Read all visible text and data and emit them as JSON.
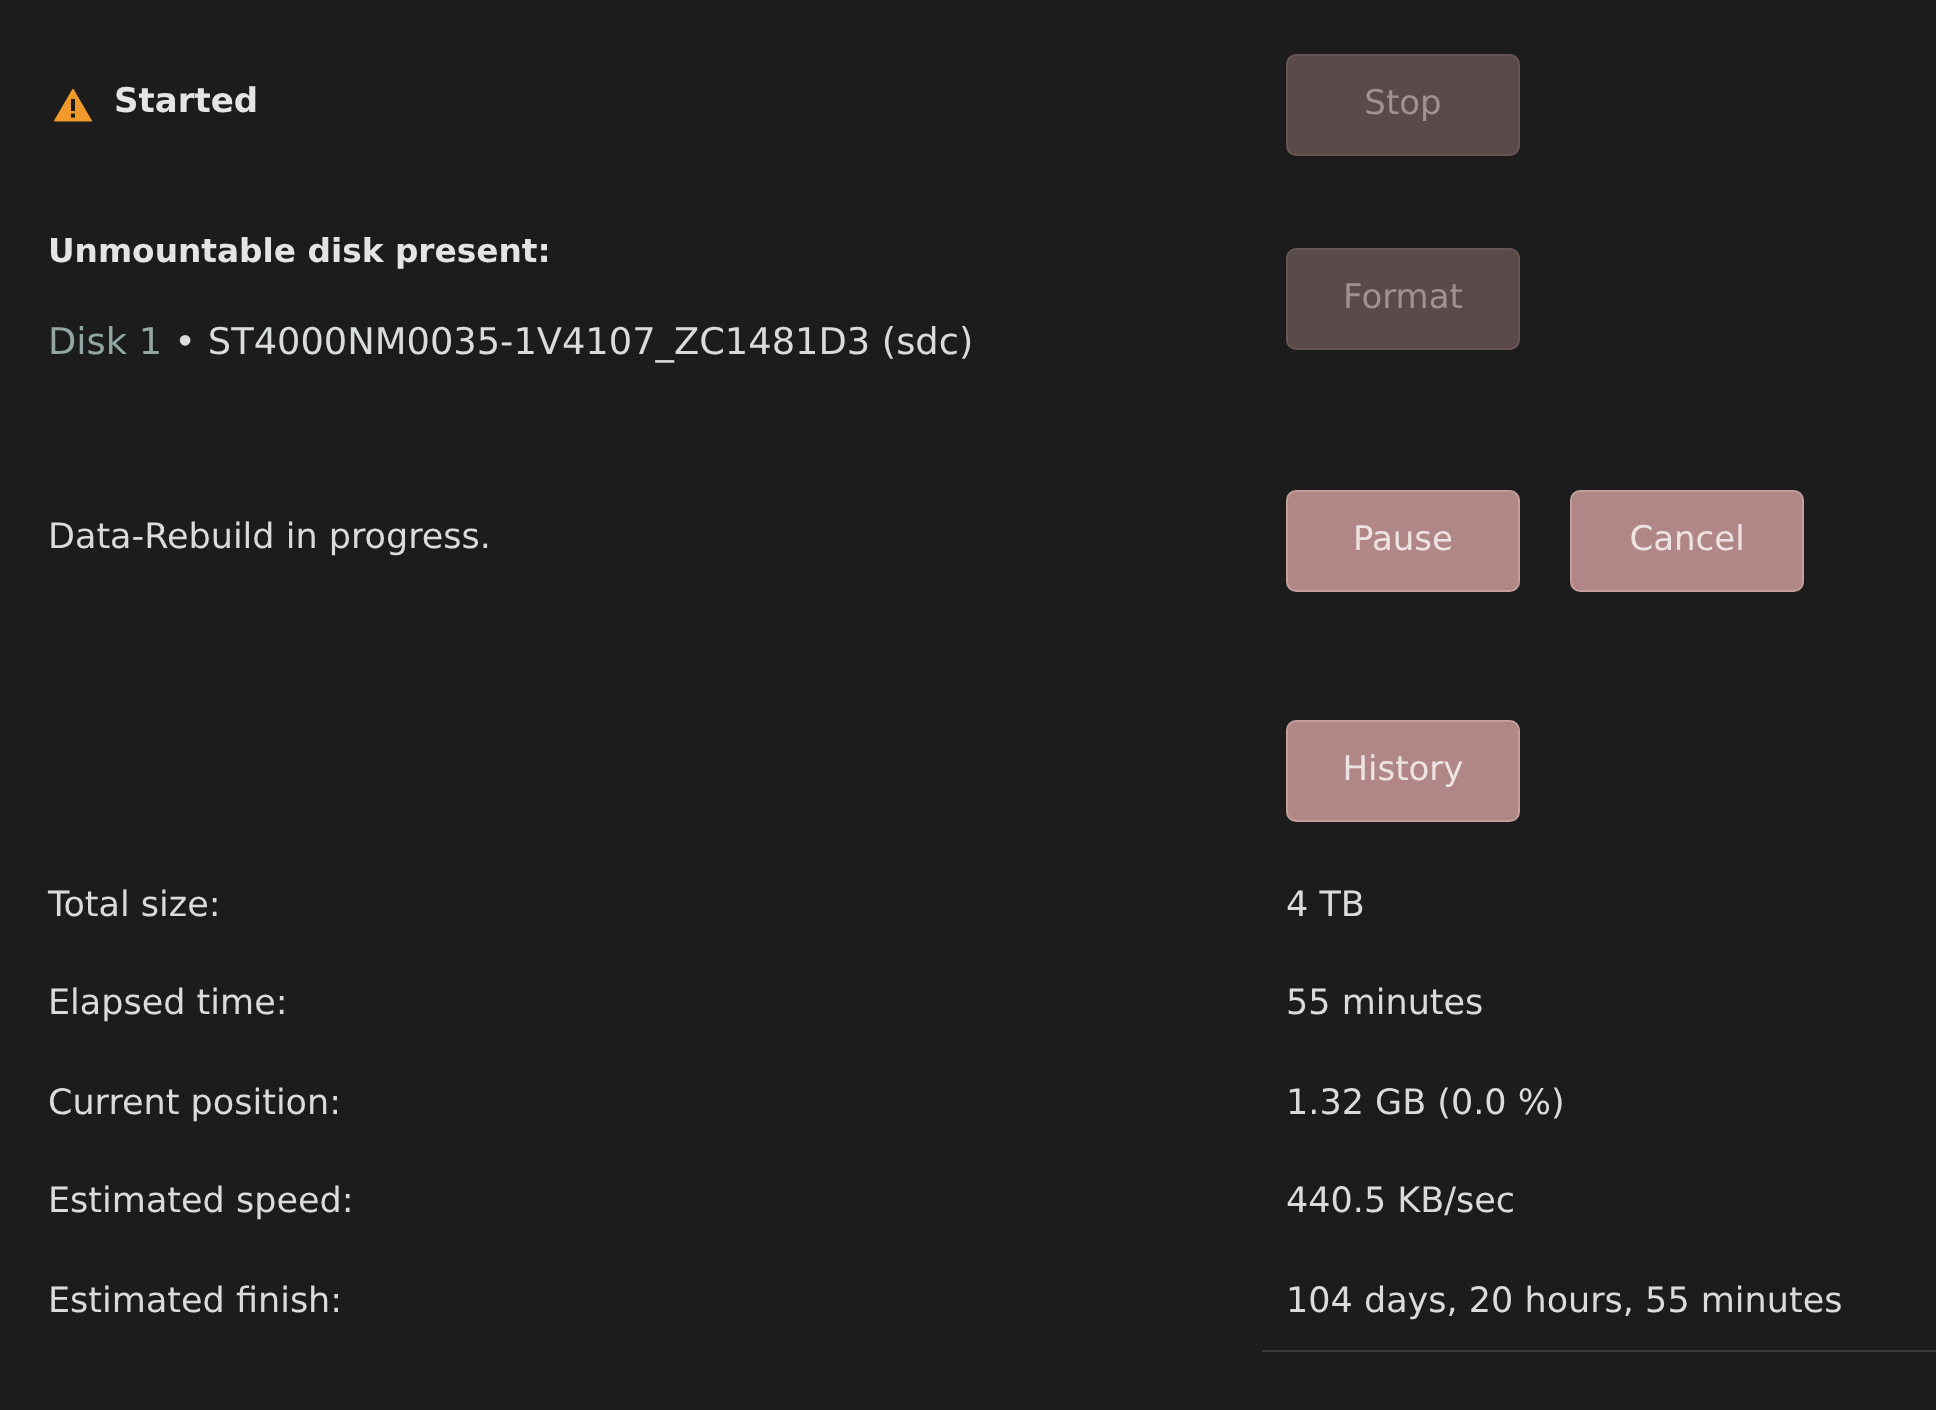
{
  "status": {
    "text": "Started"
  },
  "stop_button": {
    "label": "Stop",
    "disabled": true
  },
  "unmountable": {
    "heading": "Unmountable disk present:",
    "disks": [
      {
        "name": "Disk 1",
        "separator": "•",
        "device": "ST4000NM0035-1V4107_ZC1481D3 (sdc)"
      }
    ]
  },
  "format_button": {
    "label": "Format",
    "disabled": true
  },
  "operation": {
    "message": "Data-Rebuild in progress.",
    "buttons": [
      {
        "label": "Pause",
        "disabled": false
      },
      {
        "label": "Cancel",
        "disabled": false
      }
    ]
  },
  "history_button": {
    "label": "History",
    "disabled": false
  },
  "stats": [
    {
      "label": "Total size:",
      "value": "4 TB"
    },
    {
      "label": "Elapsed time:",
      "value": "55 minutes"
    },
    {
      "label": "Current position:",
      "value": "1.32 GB (0.0 %)"
    },
    {
      "label": "Estimated speed:",
      "value": "440.5 KB/sec"
    },
    {
      "label": "Estimated finish:",
      "value": "104 days, 20 hours, 55 minutes"
    }
  ]
}
